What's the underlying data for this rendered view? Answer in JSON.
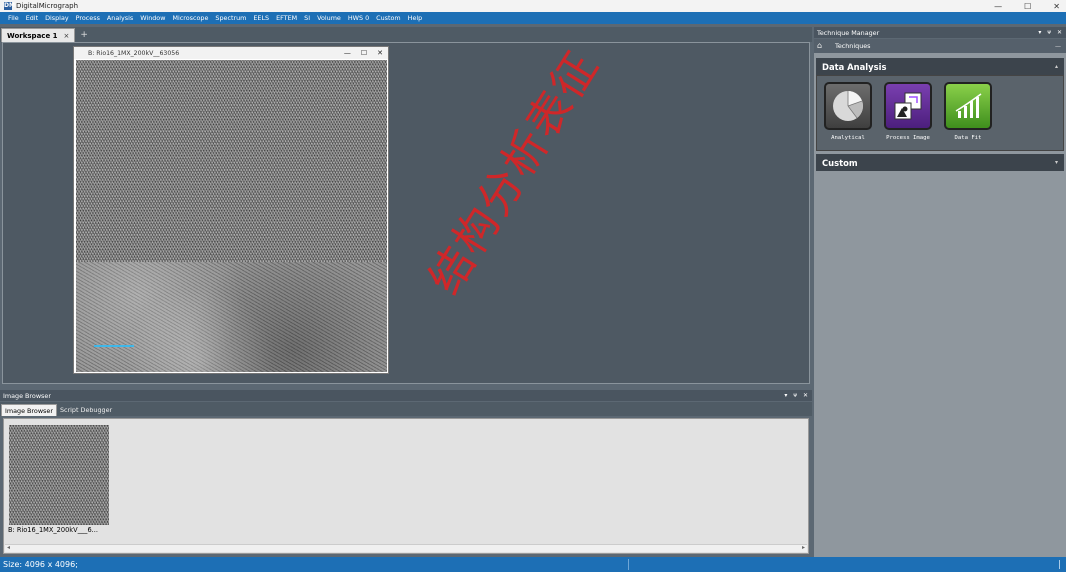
{
  "window": {
    "title": "DigitalMicrograph",
    "app_icon": "DM",
    "minimize": "—",
    "maximize": "☐",
    "close": "✕"
  },
  "menu": [
    "File",
    "Edit",
    "Display",
    "Process",
    "Analysis",
    "Window",
    "Microscope",
    "Spectrum",
    "EELS",
    "EFTEM",
    "SI",
    "Volume",
    "HWS 0",
    "Custom",
    "Help"
  ],
  "workspace": {
    "tab_label": "Workspace 1",
    "tab_close": "×",
    "add_tab": "+"
  },
  "image_window": {
    "title": "B: Rio16_1MX_200kV__63056",
    "minimize": "—",
    "maximize": "☐",
    "close": "✕"
  },
  "watermark": "结构分析表征",
  "image_browser": {
    "title": "Image Browser",
    "controls": [
      "▾",
      "ᴪ",
      "✕"
    ],
    "tabs": [
      "Image Browser",
      "Script Debugger"
    ],
    "thumbnail_caption": "B: Rio16_1MX_200kV___6...",
    "scroll_left": "◂",
    "scroll_right": "▸"
  },
  "technique_manager": {
    "title": "Technique Manager",
    "controls": [
      "▾",
      "ᴪ",
      "✕"
    ],
    "toolbar_label": "Techniques",
    "home_icon": "⌂",
    "pin": "—",
    "sections": [
      {
        "label": "Data Analysis",
        "chevron": "▴"
      },
      {
        "label": "Custom",
        "chevron": "▾"
      }
    ],
    "tools": [
      {
        "label": "Analytical",
        "icon": "pie-chart-icon"
      },
      {
        "label": "Process Image",
        "icon": "process-image-icon"
      },
      {
        "label": "Data Fit",
        "icon": "data-fit-icon"
      }
    ]
  },
  "status": {
    "text": "Size: 4096 x 4096;"
  }
}
